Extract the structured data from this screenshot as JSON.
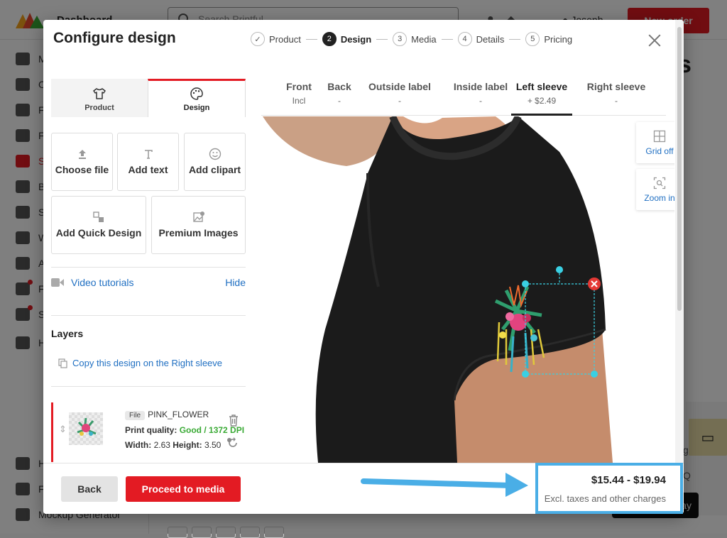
{
  "background": {
    "app_title": "Dashboard",
    "search_placeholder": "Search Printful",
    "user_name": "Joseph",
    "new_order_label": "New order",
    "heading_fragment": "s",
    "right_fragment_g": "g",
    "right_fragment_q": "Q",
    "black_button_fragment": "ay",
    "sidebar": [
      {
        "label": "M"
      },
      {
        "label": "O"
      },
      {
        "label": "F"
      },
      {
        "label": "F"
      },
      {
        "label": "S"
      },
      {
        "label": "B"
      },
      {
        "label": "S"
      },
      {
        "label": "W"
      },
      {
        "label": "A"
      },
      {
        "label": "F"
      },
      {
        "label": "S"
      },
      {
        "label": "H"
      },
      {
        "label": "H"
      },
      {
        "label": "F"
      },
      {
        "label": "Mockup Generator"
      }
    ]
  },
  "modal": {
    "title": "Configure design",
    "steps": [
      {
        "num": "✓",
        "label": "Product"
      },
      {
        "num": "2",
        "label": "Design"
      },
      {
        "num": "3",
        "label": "Media"
      },
      {
        "num": "4",
        "label": "Details"
      },
      {
        "num": "5",
        "label": "Pricing"
      }
    ],
    "left_tabs": {
      "product": "Product",
      "design": "Design"
    },
    "tools": {
      "choose_file": "Choose file",
      "add_text": "Add text",
      "add_clipart": "Add clipart",
      "add_quick_design": "Add Quick Design",
      "premium_images": "Premium Images"
    },
    "video_tutorials": "Video tutorials",
    "hide": "Hide",
    "layers_title": "Layers",
    "copy_design": "Copy this design on the Right sleeve",
    "layer": {
      "badge": "File",
      "name": "PINK_FLOWER",
      "quality_label": "Print quality:",
      "quality_value": "Good / 1372 DPI",
      "width_label": "Width:",
      "width_value": "2.63",
      "height_label": "Height:",
      "height_value": "3.50"
    },
    "placements": [
      {
        "label": "Front",
        "price": "Incl"
      },
      {
        "label": "Back",
        "price": "-"
      },
      {
        "label": "Outside label",
        "price": "-"
      },
      {
        "label": "Inside label",
        "price": "-"
      },
      {
        "label": "Left sleeve",
        "price": "+ $2.49"
      },
      {
        "label": "Right sleeve",
        "price": "-"
      }
    ],
    "grid_off": "Grid off",
    "zoom_in": "Zoom in",
    "back_label": "Back",
    "proceed_label": "Proceed to media"
  },
  "price": {
    "range": "$15.44 - $19.94",
    "note": "Excl. taxes and other charges"
  },
  "colors": {
    "brand_red": "#e31b23",
    "link_blue": "#1f6fc2",
    "annotation_blue": "#4aaee6",
    "good_green": "#3aaa35"
  }
}
